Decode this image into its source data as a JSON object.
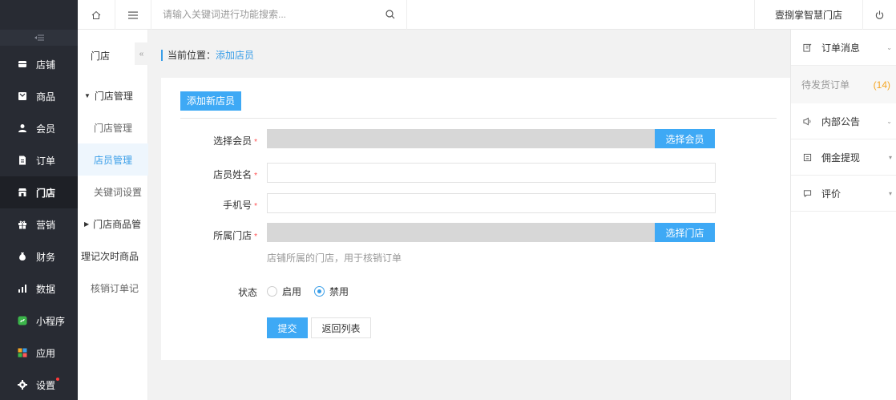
{
  "header": {
    "search_placeholder": "请输入关键词进行功能搜索...",
    "shop_name": "壹捌掌智慧门店"
  },
  "sidebar": {
    "items": [
      {
        "label": "店铺",
        "icon": "store-icon"
      },
      {
        "label": "商品",
        "icon": "goods-icon"
      },
      {
        "label": "会员",
        "icon": "user-icon"
      },
      {
        "label": "订单",
        "icon": "order-icon"
      },
      {
        "label": "门店",
        "icon": "shop-icon"
      },
      {
        "label": "营销",
        "icon": "gift-icon"
      },
      {
        "label": "财务",
        "icon": "finance-icon"
      },
      {
        "label": "数据",
        "icon": "chart-icon"
      },
      {
        "label": "小程序",
        "icon": "miniprogram-icon"
      },
      {
        "label": "应用",
        "icon": "apps-icon"
      },
      {
        "label": "设置",
        "icon": "gear-icon"
      }
    ]
  },
  "subnav": {
    "title": "门店",
    "items": [
      {
        "label": "门店管理"
      },
      {
        "label": "门店管理"
      },
      {
        "label": "店员管理"
      },
      {
        "label": "关键词设置"
      },
      {
        "label": "门店商品管"
      },
      {
        "label": "理记次时商品"
      },
      {
        "label": "核销订单记"
      }
    ]
  },
  "breadcrumb": {
    "prefix": "当前位置：",
    "current": "添加店员"
  },
  "form": {
    "add_button": "添加新店员",
    "member_label": "选择会员",
    "member_button": "选择会员",
    "name_label": "店员姓名",
    "name_value": "",
    "phone_label": "手机号",
    "phone_value": "",
    "store_label": "所属门店",
    "store_button": "选择门店",
    "store_hint": "店铺所属的门店，用于核销订单",
    "required_mark": "*",
    "status_label": "状态",
    "status_options": [
      {
        "label": "启用",
        "selected": false
      },
      {
        "label": "禁用",
        "selected": true
      }
    ],
    "submit_label": "提交",
    "back_label": "返回列表"
  },
  "right_panel": {
    "order_messages": "订单消息",
    "pending_orders": "待发货订单",
    "pending_count": "(14)",
    "announcements": "内部公告",
    "commission": "佣金提现",
    "reviews": "评价"
  },
  "colors": {
    "accent": "#3ea9f5",
    "sidebar_bg": "#282b33",
    "required": "#ff4d4f",
    "count": "#f5a623"
  }
}
